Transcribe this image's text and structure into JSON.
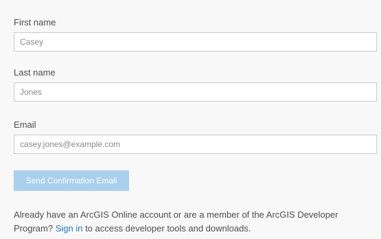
{
  "form": {
    "first_name": {
      "label": "First name",
      "value": "Casey"
    },
    "last_name": {
      "label": "Last name",
      "value": "Jones"
    },
    "email": {
      "label": "Email",
      "value": "casey.jones@example.com"
    },
    "submit_label": "Send Confirmation Email"
  },
  "footer": {
    "text_before": "Already have an ArcGIS Online account or are a member of the ArcGIS Developer Program?",
    "link_label": "Sign in",
    "text_after": "to access developer tools and downloads."
  },
  "colors": {
    "panel_background": "#f8f8f8",
    "button_disabled": "#a9d0ec",
    "link": "#2d76b8",
    "text": "#4c4c4c"
  }
}
